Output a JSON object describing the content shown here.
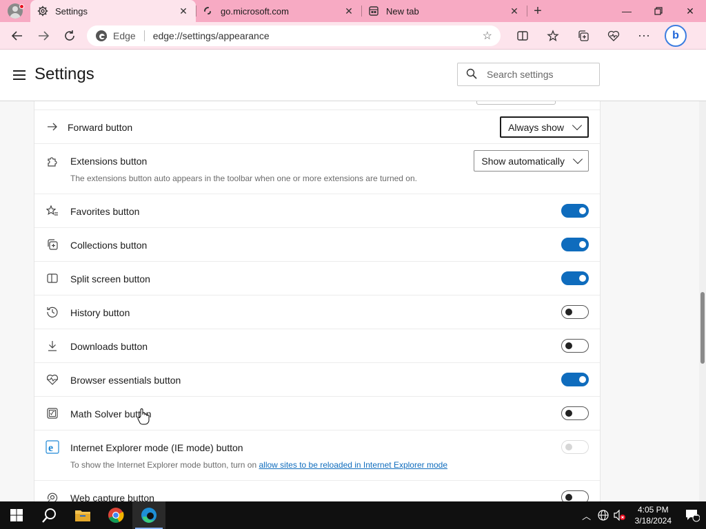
{
  "browser": {
    "tabs": [
      {
        "label": "Settings",
        "active": true
      },
      {
        "label": "go.microsoft.com",
        "active": false
      },
      {
        "label": "New tab",
        "active": false
      }
    ],
    "address": {
      "brand": "Edge",
      "url": "edge://settings/appearance"
    }
  },
  "settings": {
    "title": "Settings",
    "search_placeholder": "Search settings",
    "rows": [
      {
        "id": "forward",
        "label": "Forward button",
        "control": "dropdown",
        "value": "Always show"
      },
      {
        "id": "extensions",
        "label": "Extensions button",
        "control": "dropdown",
        "value": "Show automatically",
        "description": "The extensions button auto appears in the toolbar when one or more extensions are turned on."
      },
      {
        "id": "favorites",
        "label": "Favorites button",
        "control": "toggle",
        "on": true
      },
      {
        "id": "collections",
        "label": "Collections button",
        "control": "toggle",
        "on": true
      },
      {
        "id": "split",
        "label": "Split screen button",
        "control": "toggle",
        "on": true
      },
      {
        "id": "history",
        "label": "History button",
        "control": "toggle",
        "on": false
      },
      {
        "id": "downloads",
        "label": "Downloads button",
        "control": "toggle",
        "on": false
      },
      {
        "id": "essentials",
        "label": "Browser essentials button",
        "control": "toggle",
        "on": true
      },
      {
        "id": "math",
        "label": "Math Solver button",
        "control": "toggle",
        "on": false
      },
      {
        "id": "iemode",
        "label": "Internet Explorer mode (IE mode) button",
        "control": "toggle",
        "on": false,
        "disabled": true,
        "description_prefix": "To show the Internet Explorer mode button, turn on ",
        "description_link": "allow sites to be reloaded in Internet Explorer mode"
      },
      {
        "id": "webcapture",
        "label": "Web capture button",
        "control": "toggle",
        "on": false
      }
    ]
  },
  "taskbar": {
    "time": "4:05 PM",
    "date": "3/18/2024",
    "notification_count": "1"
  },
  "colors": {
    "tabbar": "#f7aac3",
    "toolbar": "#fde4ec",
    "accent": "#0f6cbd"
  }
}
